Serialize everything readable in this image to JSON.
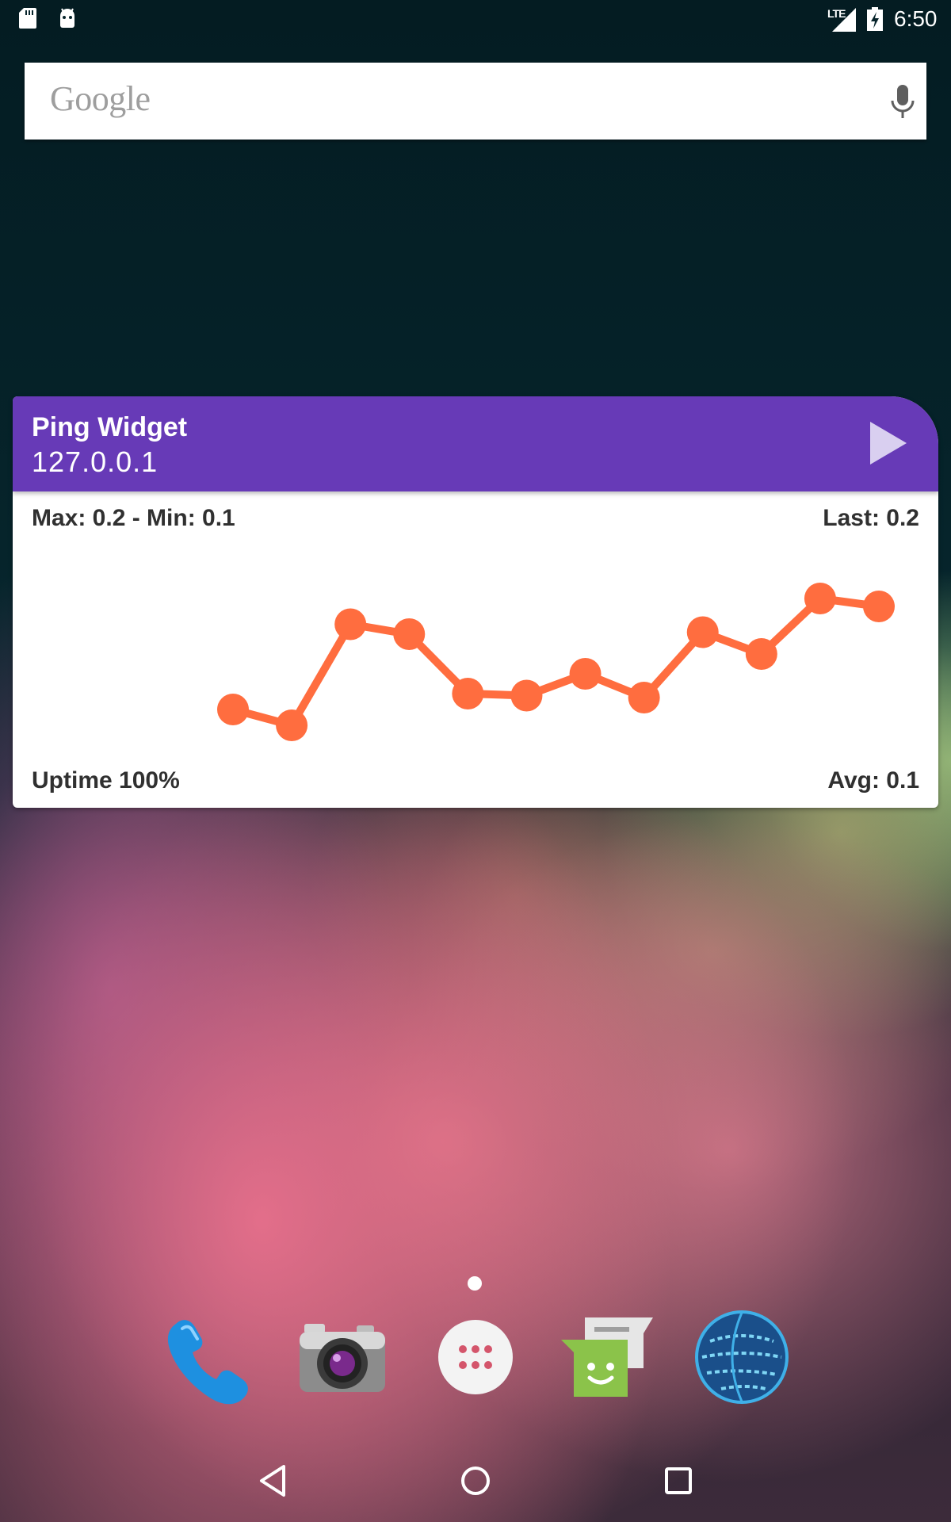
{
  "status_bar": {
    "network_label": "LTE",
    "time": "6:50",
    "icons": [
      "sd-card-icon",
      "android-debug-icon",
      "signal-icon",
      "battery-charging-icon"
    ]
  },
  "search_bar": {
    "logo_text": "Google",
    "icon": "mic-icon"
  },
  "widget": {
    "title": "Ping Widget",
    "host": "127.0.0.1",
    "max_min": "Max: 0.2 - Min: 0.1",
    "last": "Last: 0.2",
    "uptime": "Uptime 100%",
    "avg": "Avg: 0.1",
    "header_color": "#673ab7",
    "play_icon": "play-icon"
  },
  "chart_data": {
    "type": "line",
    "x": [
      1,
      2,
      3,
      4,
      5,
      6,
      7,
      8,
      9,
      10,
      11,
      12
    ],
    "series": [
      {
        "values": [
          0.118,
          0.11,
          0.161,
          0.156,
          0.126,
          0.125,
          0.136,
          0.124,
          0.157,
          0.146,
          0.174,
          0.17
        ]
      }
    ],
    "ylim": [
      0.1,
      0.2
    ],
    "color": "#ff6d3f",
    "grid": false,
    "legend": "none"
  },
  "home": {
    "page_indicator_count": 1
  },
  "dock": {
    "apps": [
      "phone-app-icon",
      "camera-app-icon",
      "app-drawer-icon",
      "messenger-app-icon",
      "browser-app-icon"
    ]
  },
  "nav_bar": {
    "buttons": [
      "back-icon",
      "home-icon",
      "recents-icon"
    ]
  }
}
